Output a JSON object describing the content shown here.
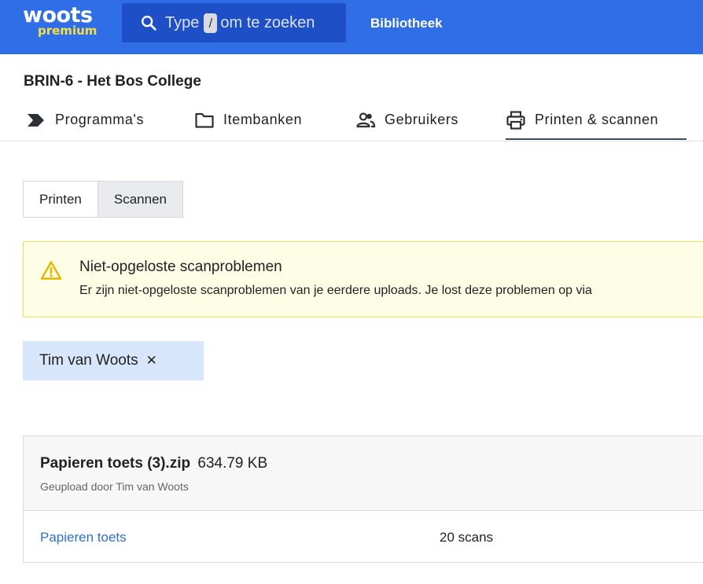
{
  "brand": {
    "logo_main": "woots",
    "logo_sub": "premium"
  },
  "search": {
    "prefix": "Type",
    "shortcut_key": "/",
    "suffix": "om te zoeken"
  },
  "topnav": {
    "library": "Bibliotheek"
  },
  "organization": {
    "title": "BRIN-6 - Het Bos College"
  },
  "tabs": [
    {
      "label": "Programma's",
      "icon": "tag-arrow-icon"
    },
    {
      "label": "Itembanken",
      "icon": "folder-icon"
    },
    {
      "label": "Gebruikers",
      "icon": "users-icon"
    },
    {
      "label": "Printen & scannen",
      "icon": "printer-icon",
      "active": true
    }
  ],
  "segment": {
    "print_label": "Printen",
    "scan_label": "Scannen",
    "selected": "Scannen"
  },
  "alert": {
    "title": "Niet-opgeloste scanproblemen",
    "body": "Er zijn niet-opgeloste scanproblemen van je eerdere uploads. Je lost deze problemen op via"
  },
  "filter_chip": {
    "label": "Tim van Woots",
    "close": "✕"
  },
  "upload": {
    "file_name": "Papieren toets (3).zip",
    "file_size": "634.79 KB",
    "uploaded_by": "Geupload  door Tim van Woots",
    "rows": [
      {
        "link": "Papieren toets",
        "count": "20 scans"
      }
    ]
  },
  "colors": {
    "topbar": "#2f6ee6",
    "search_bg": "#1f4fc7",
    "logo_sub": "#f5e04a",
    "alert_bg": "#fefde6",
    "alert_border": "#ece35b",
    "chip_bg": "#d7e6fb",
    "link": "#2e6fd1"
  }
}
